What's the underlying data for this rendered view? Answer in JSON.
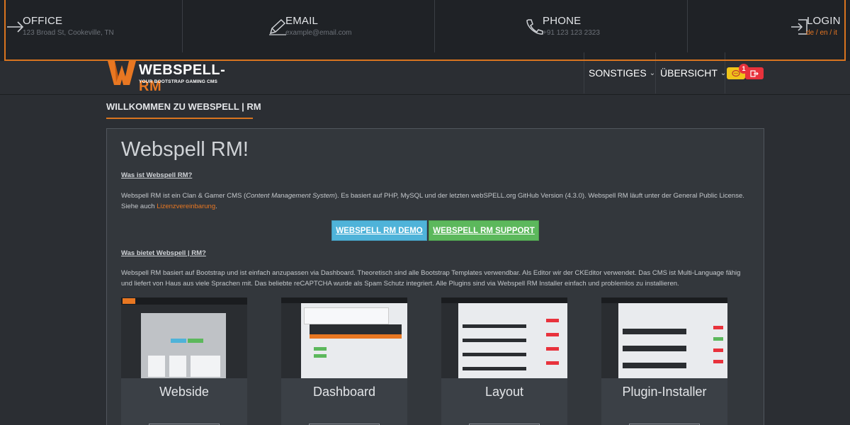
{
  "topbar": {
    "office": {
      "title": "OFFICE",
      "sub": "123 Broad St, Cookeville, TN",
      "icon": "arrow-right-icon"
    },
    "email": {
      "title": "EMAIL",
      "sub": "example@email.com",
      "icon": "pencil-icon"
    },
    "phone": {
      "title": "PHONE",
      "sub": "+91 123 123 2323",
      "icon": "phone-icon"
    },
    "login": {
      "title": "LOGIN",
      "langs": "de / en / it",
      "icon": "login-icon"
    }
  },
  "header": {
    "logo_text_a": "WEBSPELL-",
    "logo_text_b": "RM",
    "logo_tagline": "YOUR BOOTSTRAP GAMING CMS",
    "nav": [
      {
        "label": "SONSTIGES"
      },
      {
        "label": "ÜBERSICHT"
      }
    ],
    "message_badge": "1"
  },
  "page": {
    "heading": "WILLKOMMEN ZU WEBSPELL | RM",
    "title": "Webspell RM!",
    "q1": "Was ist Webspell RM?",
    "p1_a": "Webspell RM ist ein Clan & Gamer CMS (",
    "p1_em": "Content Management System",
    "p1_b": "). Es basiert auf PHP, MySQL und der letzten webSPELL.org GitHub Version (4.3.0). Webspell RM läuft unter der General Public License. Siehe auch ",
    "p1_link": "Lizenzvereinbarung",
    "p1_end": ".",
    "btn_demo": "WEBSPELL RM DEMO",
    "btn_support": "WEBSPELL RM SUPPORT",
    "q2": "Was bietet Webspell | RM?",
    "p2": "Webspell RM basiert auf Bootstrap und ist einfach anzupassen via Dashboard. Theoretisch sind alle Bootstrap Templates verwendbar. Als Editor wir der CKEditor verwendet. Das CMS ist Multi-Language fähig und liefert von Haus aus viele Sprachen mit. Das beliebte reCAPTCHA wurde als Spam Schutz integriert. Alle Plugins sind via Webspell RM Installer einfach und problemlos zu installieren.",
    "cards": [
      {
        "title": "Webside"
      },
      {
        "title": "Dashboard"
      },
      {
        "title": "Layout"
      },
      {
        "title": "Plugin-Installer"
      }
    ]
  },
  "colors": {
    "accent": "#e87722",
    "demo_btn": "#4fb3d9",
    "support_btn": "#5cb85c",
    "chat_btn": "#f0c419",
    "logout_btn": "#e8323c"
  }
}
